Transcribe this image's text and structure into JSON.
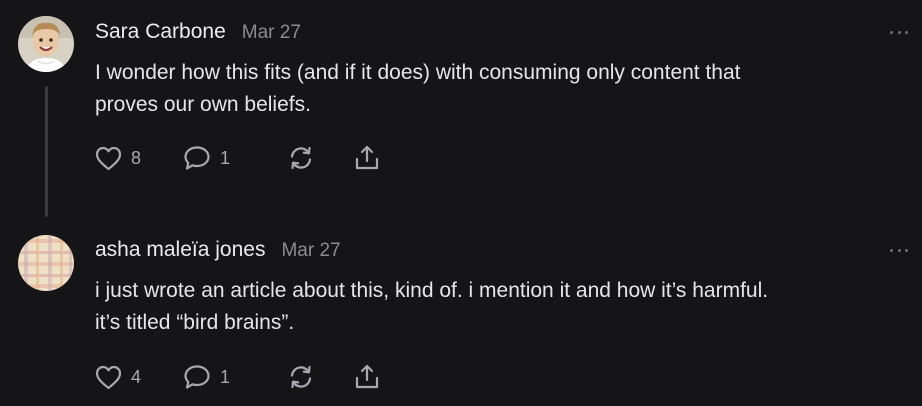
{
  "comments": [
    {
      "author": "Sara Carbone",
      "date": "Mar 27",
      "text_lines": [
        "I wonder how this fits (and if it does) with consuming only content that",
        "proves our own beliefs."
      ],
      "likes": "8",
      "replies": "1",
      "icons": {
        "like": "heart-icon",
        "reply": "comment-bubble-icon",
        "restack": "restack-icon",
        "share": "share-icon",
        "more": "more-dots-icon"
      }
    },
    {
      "author": "asha maleïa jones",
      "date": "Mar 27",
      "text_lines": [
        "i just wrote an article about this, kind of. i mention it and how it’s harmful.",
        "it’s titled “bird brains”."
      ],
      "likes": "4",
      "replies": "1",
      "icons": {
        "like": "heart-icon",
        "reply": "comment-bubble-icon",
        "restack": "restack-icon",
        "share": "share-icon",
        "more": "more-dots-icon"
      }
    }
  ],
  "colors": {
    "background": "#151518",
    "text": "#e6e6e8",
    "muted": "#8b8b92",
    "icon": "#a8a8ae",
    "thread_line": "#3a3a3f"
  }
}
